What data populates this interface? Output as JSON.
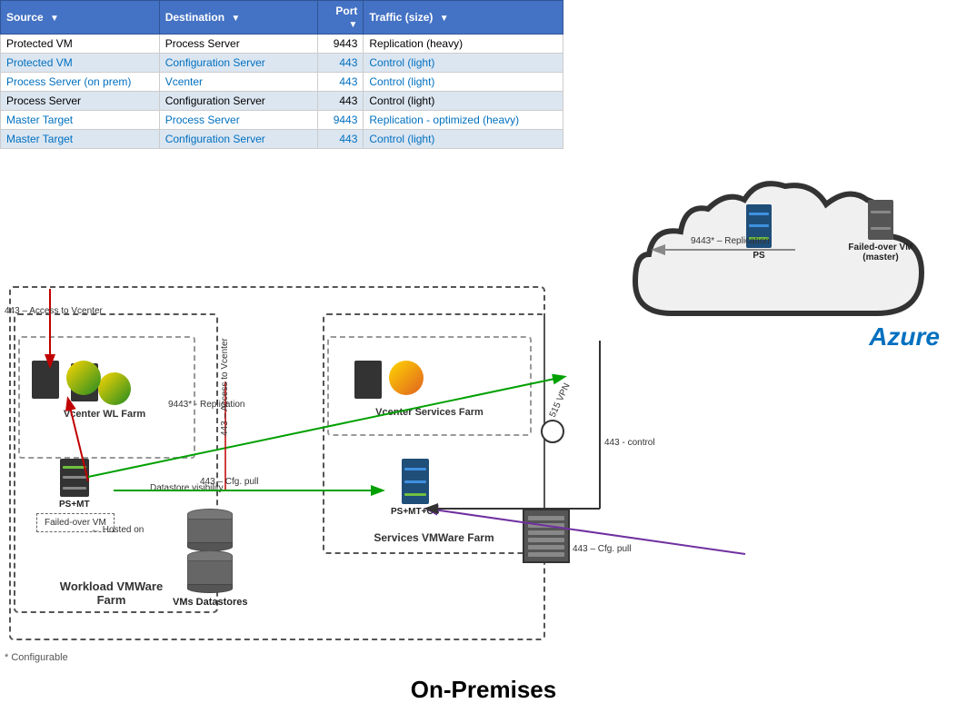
{
  "table": {
    "headers": [
      "Source",
      "Destination",
      "Port",
      "Traffic (size)"
    ],
    "rows": [
      {
        "source": "Protected VM",
        "destination": "Process Server",
        "port": "9443",
        "traffic": "Replication (heavy)",
        "style": "normal"
      },
      {
        "source": "Protected VM",
        "destination": "Configuration Server",
        "port": "443",
        "traffic": "Control (light)",
        "style": "highlight"
      },
      {
        "source": "Process Server (on prem)",
        "destination": "Vcenter",
        "port": "443",
        "traffic": "Control (light)",
        "style": "highlight"
      },
      {
        "source": "Process Server",
        "destination": "Configuration Server",
        "port": "443",
        "traffic": "Control (light)",
        "style": "normal"
      },
      {
        "source": "Master Target",
        "destination": "Process Server",
        "port": "9443",
        "traffic": "Replication - optimized (heavy)",
        "style": "highlight"
      },
      {
        "source": "Master Target",
        "destination": "Configuration Server",
        "port": "443",
        "traffic": "Control (light)",
        "style": "highlight"
      }
    ]
  },
  "diagram": {
    "azure_label": "Azure",
    "onprem_label": "On-Premises",
    "configurable_note": "* Configurable",
    "labels": {
      "ps": "PS",
      "failed_over_vm": "Failed-over VM\n(master)",
      "ps_mt": "PS+MT",
      "ps_mt_cs": "PS+MT+CS",
      "vcenter_wl_farm": "Vcenter WL Farm",
      "vcenter_svc_farm": "Vcenter Services Farm",
      "workload_vmware": "Workload VMWare\nFarm",
      "services_vmware": "Services VMWare Farm",
      "vms_datastores": "VMs Datastores",
      "failed_over_vm_onprem": "Failed-over VM"
    },
    "connections": [
      {
        "label": "9443* - Replication",
        "color": "green"
      },
      {
        "label": "9443* - Replication",
        "color": "gray"
      },
      {
        "label": "443 - Access to Vcenter",
        "color": "red"
      },
      {
        "label": "443 – Access to Vcenter",
        "color": "red"
      },
      {
        "label": "443 – Cfg. pull",
        "color": "green"
      },
      {
        "label": "443 – Cfg. pull",
        "color": "purple"
      },
      {
        "label": "443 - control",
        "color": "black"
      },
      {
        "label": "515 VPN",
        "color": "gray"
      }
    ]
  }
}
